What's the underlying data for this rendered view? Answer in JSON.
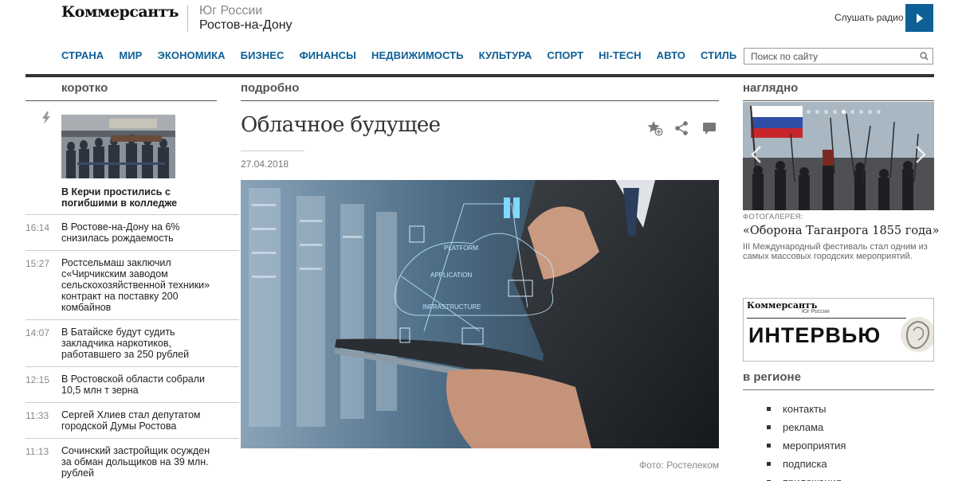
{
  "header": {
    "logo": "Коммерсантъ",
    "region_line1": "Юг России",
    "region_line2": "Ростов-на-Дону",
    "radio_label": "Слушать радио",
    "search_placeholder": "Поиск по сайту"
  },
  "nav": [
    "СТРАНА",
    "МИР",
    "ЭКОНОМИКА",
    "БИЗНЕС",
    "ФИНАНСЫ",
    "НЕДВИЖИМОСТЬ",
    "КУЛЬТУРА",
    "СПОРТ",
    "HI-TECH",
    "АВТО",
    "СТИЛЬ"
  ],
  "sections": {
    "left": "коротко",
    "middle": "подробно",
    "right": "наглядно",
    "region": "в регионе"
  },
  "lead_news": {
    "title": "В Керчи простились с погибшими в колледже"
  },
  "news": [
    {
      "time": "16:14",
      "text": "В Ростове-на-Дону на 6% снизилась рождаемость"
    },
    {
      "time": "15:27",
      "text": "Ростсельмаш заключил с«Чирчикским заводом сельскохозяйственной техники» контракт на поставку 200 комбайнов"
    },
    {
      "time": "14:07",
      "text": "В Батайске будут судить закладчика наркотиков, работавшего за 250 рублей"
    },
    {
      "time": "12:15",
      "text": "В Ростовской области собрали 10,5 млн т зерна"
    },
    {
      "time": "11:33",
      "text": "Сергей Хлиев стал депутатом городской Думы Ростова"
    },
    {
      "time": "11:13",
      "text": "Сочинский застройщик осужден за обман дольщиков на 39 млн. рублей"
    }
  ],
  "article": {
    "title": "Облачное будущее",
    "date": "27.04.2018",
    "photo_credit": "Фото: Ростелеком",
    "image_words": [
      "PLATFORM",
      "APPLICATION",
      "INFRASTRUCTURE"
    ]
  },
  "gallery": {
    "kicker": "ФОТОГАЛЕРЕЯ:",
    "title": "«Оборона Таганрога 1855 года»",
    "description": "III Международный фестиваль стал одним из самых массовых городских мероприятий.",
    "dots": 9,
    "active_dot": 4
  },
  "interview": {
    "logo": "Коммерсантъ",
    "sub": "Юг России",
    "word": "ИНТЕРВЬЮ"
  },
  "region_links": [
    "контакты",
    "реклама",
    "мероприятия",
    "подписка",
    "приложения"
  ],
  "colors": {
    "accent": "#0e5f96",
    "rule": "#333333"
  }
}
